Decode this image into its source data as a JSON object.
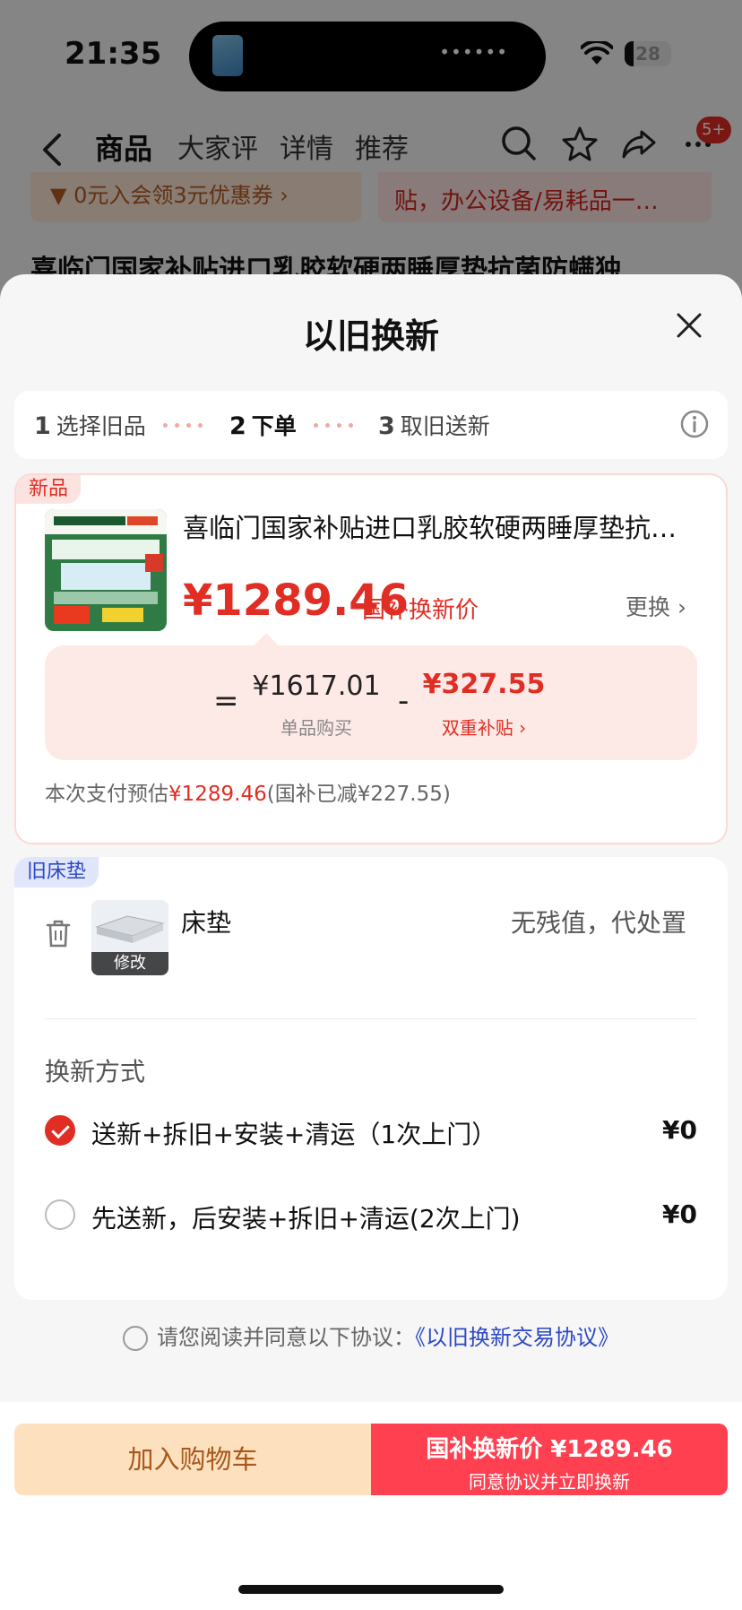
{
  "status_bar": {
    "time": "21:35",
    "battery": "28"
  },
  "nav": {
    "tabs": [
      "商品",
      "大家评",
      "详情",
      "推荐"
    ],
    "badge": "5+"
  },
  "background": {
    "coupon_text": "▼ 0元入会领3元优惠券 ›",
    "subsidy_text": "贴，办公设备/易耗品一…",
    "product_title": "喜临门国家补贴进口乳胶软硬两睡厚垫抗菌防螨独"
  },
  "sheet": {
    "title": "以旧换新",
    "steps": [
      {
        "num": "1",
        "label": "选择旧品"
      },
      {
        "num": "2",
        "label": "下单"
      },
      {
        "num": "3",
        "label": "取旧送新"
      }
    ]
  },
  "new_item": {
    "tag": "新品",
    "title": "喜临门国家补贴进口乳胶软硬两睡厚垫抗菌防螨独立弹簧床垫",
    "price": "¥1289.46",
    "price_label": "国补换新价",
    "change_label": "更换 ›",
    "unit_price": "¥1617.01",
    "unit_price_label": "单品购买",
    "subsidy": "¥327.55",
    "subsidy_label": "双重补贴 ›",
    "estimate_prefix": "本次支付预估",
    "estimate_price": "¥1289.46",
    "estimate_suffix": "(国补已减¥227.55)"
  },
  "old_item": {
    "tag": "旧床垫",
    "name": "床垫",
    "edit_label": "修改",
    "value_text": "无残值，代处置",
    "method_label": "换新方式",
    "options": [
      {
        "text": "送新+拆旧+安装+清运（1次上门）",
        "price": "¥0",
        "checked": true
      },
      {
        "text": "先送新，后安装+拆旧+清运(2次上门)",
        "price": "¥0",
        "checked": false
      }
    ]
  },
  "agreement": {
    "text": "请您阅读并同意以下协议：",
    "link": "《以旧换新交易协议》"
  },
  "footer": {
    "cart_label": "加入购物车",
    "buy_label": "国补换新价 ¥1289.46",
    "buy_sub": "同意协议并立即换新"
  },
  "colors": {
    "accent": "#e02e24",
    "link": "#2c48c4",
    "buy_button": "#ff4050",
    "cart_button": "#fde1bf"
  },
  "icons": [
    "back-arrow-icon",
    "search-icon",
    "star-icon",
    "share-icon",
    "more-icon",
    "close-icon",
    "info-icon",
    "trash-icon",
    "check-icon",
    "wifi-icon",
    "battery-icon"
  ]
}
